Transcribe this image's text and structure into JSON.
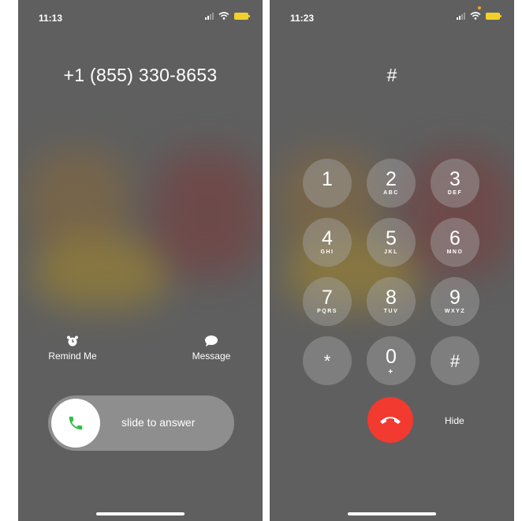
{
  "left_screen": {
    "status_time": "11:13",
    "caller_number": "+1 (855) 330-8653",
    "remind_label": "Remind Me",
    "message_label": "Message",
    "slide_label": "slide to answer"
  },
  "right_screen": {
    "status_time": "11:23",
    "dial_display": "#",
    "keys": [
      {
        "digit": "1",
        "letters": ""
      },
      {
        "digit": "2",
        "letters": "ABC"
      },
      {
        "digit": "3",
        "letters": "DEF"
      },
      {
        "digit": "4",
        "letters": "GHI"
      },
      {
        "digit": "5",
        "letters": "JKL"
      },
      {
        "digit": "6",
        "letters": "MNO"
      },
      {
        "digit": "7",
        "letters": "PQRS"
      },
      {
        "digit": "8",
        "letters": "TUV"
      },
      {
        "digit": "9",
        "letters": "WXYZ"
      },
      {
        "digit": "*",
        "letters": ""
      },
      {
        "digit": "0",
        "letters": "+"
      },
      {
        "digit": "#",
        "letters": ""
      }
    ],
    "hide_label": "Hide"
  },
  "colors": {
    "background": "#5f5f5f",
    "end_call": "#f23a30",
    "answer_icon": "#2fbf4a",
    "battery": "#f2d02b"
  },
  "icons": [
    "alarm-clock-icon",
    "speech-bubble-icon",
    "phone-icon",
    "end-call-icon",
    "cellular-signal-icon",
    "wifi-icon",
    "battery-icon"
  ]
}
